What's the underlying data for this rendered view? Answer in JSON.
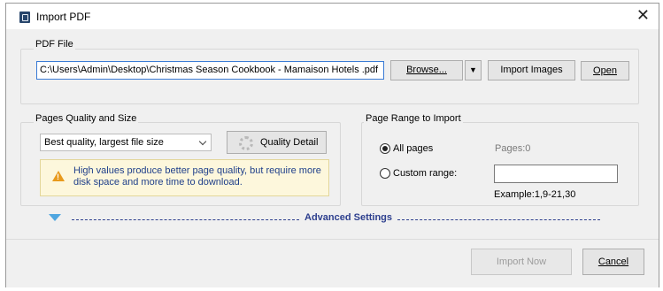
{
  "window": {
    "title": "Import PDF",
    "close_glyph": "✕"
  },
  "pdf_file": {
    "group_label": "PDF File",
    "path_value": "C:\\Users\\Admin\\Desktop\\Christmas Season Cookbook - Mamaison Hotels .pdf",
    "browse_label": "Browse...",
    "dropdown_glyph": "▼",
    "import_images_label": "Import Images",
    "open_label": "Open"
  },
  "quality": {
    "group_label": "Pages Quality and Size",
    "selected_option": "Best quality, largest file size",
    "quality_detail_label": "Quality Detail",
    "warning_text": "High values produce better page quality, but require more disk space and more time to download.",
    "warning_glyph": "!"
  },
  "page_range": {
    "group_label": "Page Range to Import",
    "all_pages_label": "All pages",
    "pages_count": "Pages:0",
    "custom_range_label": "Custom range:",
    "custom_range_value": "",
    "example_text": "Example:1,9-21,30"
  },
  "advanced": {
    "label": "Advanced Settings"
  },
  "footer": {
    "import_now_label": "Import Now",
    "cancel_label": "Cancel"
  },
  "colors": {
    "accent_blue": "#2d3f8e",
    "warning_bg": "#fdf7dc",
    "warning_text": "#1f3f8a"
  }
}
